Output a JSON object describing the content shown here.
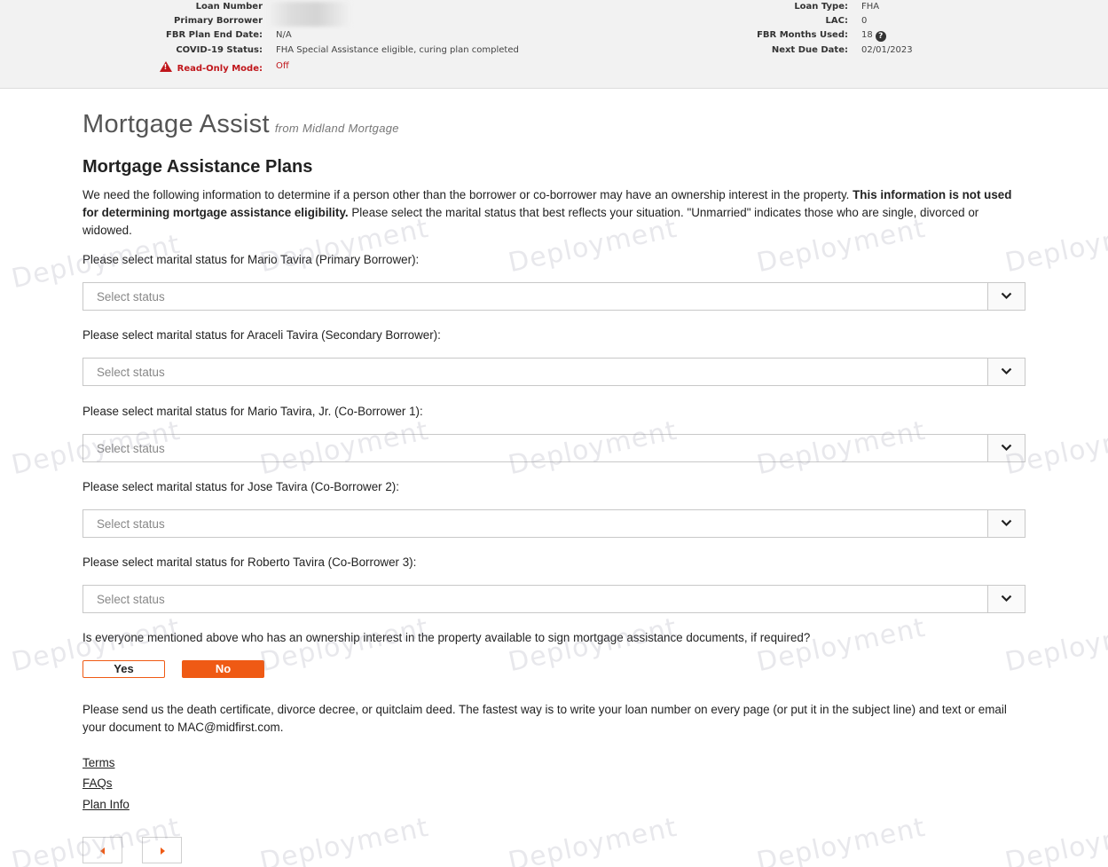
{
  "loan_info": {
    "left": [
      {
        "label": "Loan Number",
        "value": ""
      },
      {
        "label": "Primary Borrower",
        "value": ""
      },
      {
        "label": "FBR Plan End Date:",
        "value": "N/A"
      },
      {
        "label": "COVID-19 Status:",
        "value": "FHA Special Assistance eligible, curing plan completed"
      },
      {
        "label": "Read-Only Mode:",
        "value": "Off"
      }
    ],
    "right": [
      {
        "label": "Loan Type:",
        "value": "FHA"
      },
      {
        "label": "LAC:",
        "value": "0"
      },
      {
        "label": "FBR Months Used:",
        "value": "18"
      },
      {
        "label": "Next Due Date:",
        "value": "02/01/2023"
      }
    ]
  },
  "app": {
    "title": "Mortgage Assist",
    "subtitle": "from Midland Mortgage"
  },
  "page": {
    "section_title": "Mortgage Assistance Plans",
    "intro_part1": "We need the following information to determine if a person other than the borrower or co-borrower may have an ownership interest in the property. ",
    "intro_bold": "This information is not used for determining mortgage assistance eligibility.",
    "intro_part2": " Please select the marital status that best reflects your situation. \"Unmarried\" indicates those who are single, divorced or widowed."
  },
  "questions": [
    {
      "label": "Please select marital status for Mario Tavira (Primary Borrower):",
      "placeholder": "Select status"
    },
    {
      "label": "Please select marital status for Araceli Tavira (Secondary Borrower):",
      "placeholder": "Select status"
    },
    {
      "label": "Please select marital status for Mario Tavira, Jr. (Co-Borrower 1):",
      "placeholder": "Select status"
    },
    {
      "label": "Please select marital status for Jose Tavira (Co-Borrower 2):",
      "placeholder": "Select status"
    },
    {
      "label": "Please select marital status for Roberto Tavira (Co-Borrower 3):",
      "placeholder": "Select status"
    }
  ],
  "sign_question": {
    "label": "Is everyone mentioned above who has an ownership interest in the property available to sign mortgage assistance documents, if required?",
    "yes_label": "Yes",
    "no_label": "No",
    "selected": "No"
  },
  "send_text": "Please send us the death certificate, divorce decree, or quitclaim deed. The fastest way is to write your loan number on every page (or put it in the subject line) and text or email your document to MAC@midfirst.com.",
  "footer_links": [
    "Terms",
    "FAQs",
    "Plan Info"
  ],
  "watermark": "Deployment",
  "colors": {
    "accent": "#ef5a14",
    "warning": "#c0161b",
    "header_bg": "#f2f2f2"
  },
  "icons": {
    "read_only": "warning-icon",
    "fbr_months": "help-icon",
    "select_toggle": "chevron-down-icon",
    "prev": "caret-left-icon",
    "next": "caret-right-icon"
  }
}
